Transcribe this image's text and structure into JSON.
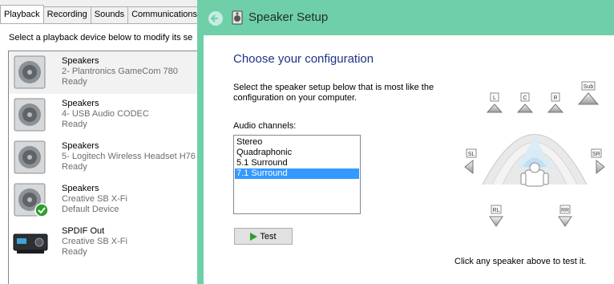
{
  "sound_panel": {
    "tabs": [
      {
        "label": "Playback",
        "active": true
      },
      {
        "label": "Recording",
        "active": false
      },
      {
        "label": "Sounds",
        "active": false
      },
      {
        "label": "Communications",
        "active": false
      }
    ],
    "instruction": "Select a playback device below to modify its se",
    "devices": [
      {
        "name": "Speakers",
        "description": "2- Plantronics GameCom 780",
        "status": "Ready",
        "icon": "speaker-icon",
        "selected": true
      },
      {
        "name": "Speakers",
        "description": "4- USB Audio CODEC",
        "status": "Ready",
        "icon": "speaker-icon"
      },
      {
        "name": "Speakers",
        "description": "5- Logitech Wireless Headset H76",
        "status": "Ready",
        "icon": "speaker-icon"
      },
      {
        "name": "Speakers",
        "description": "Creative SB X-Fi",
        "status": "Default Device",
        "icon": "speaker-icon",
        "default": true
      },
      {
        "name": "SPDIF Out",
        "description": "Creative SB X-Fi",
        "status": "Ready",
        "icon": "spdif-device-icon"
      }
    ]
  },
  "wizard": {
    "title": "Speaker Setup",
    "heading": "Choose your configuration",
    "description": "Select the speaker setup below that is most like the configuration on your computer.",
    "channels_label": "Audio channels:",
    "channels": [
      "Stereo",
      "Quadraphonic",
      "5.1 Surround",
      "7.1 Surround"
    ],
    "selected_channel": "7.1 Surround",
    "test_label": "Test",
    "hint": "Click any speaker above to test it.",
    "speaker_labels": {
      "left": "L",
      "center": "C",
      "right": "R",
      "sub": "Sub",
      "side_left": "SL",
      "side_right": "SR",
      "rear_left": "RL",
      "rear_right": "RR"
    },
    "accent_color": "#6fcfa9"
  }
}
